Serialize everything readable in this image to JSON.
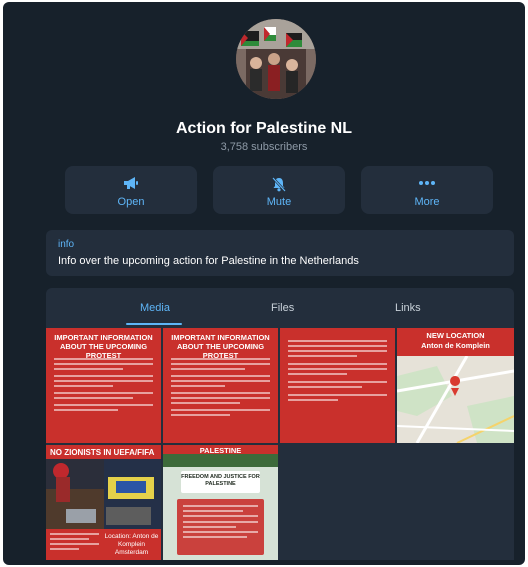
{
  "channel": {
    "name": "Action for Palestine NL",
    "subscribers": "3,758 subscribers"
  },
  "actions": [
    {
      "label": "Open",
      "icon": "megaphone-icon"
    },
    {
      "label": "Mute",
      "icon": "bell-muted-icon"
    },
    {
      "label": "More",
      "icon": "dots-icon"
    }
  ],
  "info": {
    "label": "info",
    "text": "Info over the upcoming action for Palestine in the Netherlands"
  },
  "tabs": [
    {
      "label": "Media",
      "active": true
    },
    {
      "label": "Files",
      "active": false
    },
    {
      "label": "Links",
      "active": false
    }
  ],
  "media": [
    {
      "heading": "IMPORTANT INFORMATION ABOUT THE UPCOMING PROTEST"
    },
    {
      "heading": "IMPORTANT INFORMATION ABOUT THE UPCOMING PROTEST"
    },
    {
      "heading": ""
    },
    {
      "heading": "NEW LOCATION",
      "subheading": "Anton de Komplein"
    },
    {
      "heading": "NO ZIONISTS IN UEFA/FIFA",
      "caption": "Location: Anton de Komplein Amsterdam"
    },
    {
      "heading": "PALESTINE",
      "caption": "FREEDOM AND JUSTICE FOR PALESTINE"
    }
  ],
  "colors": {
    "background": "#17212b",
    "panel": "#232e3c",
    "accent": "#5eb5f7",
    "flyer_red": "#c9302c"
  }
}
